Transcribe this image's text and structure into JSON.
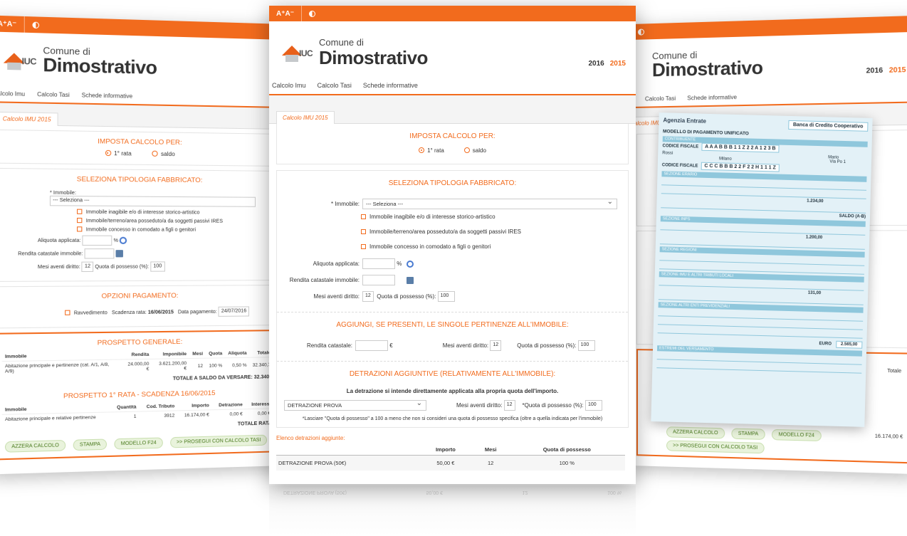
{
  "app": {
    "fontsize_label": "A⁺A⁻",
    "comune_label": "Comune di",
    "comune_name": "Dimostrativo",
    "logo_text": "IUC",
    "year_2016": "2016",
    "year_2015": "2015",
    "accent": "#f26b1d"
  },
  "nav": {
    "calcolo_imu": "Calcolo Imu",
    "calcolo_tasi": "Calcolo Tasi",
    "schede": "Schede informative"
  },
  "tab": {
    "label": "Calcolo IMU 2015"
  },
  "imposta": {
    "title": "IMPOSTA CALCOLO PER:",
    "prima_rata": "1° rata",
    "saldo": "saldo"
  },
  "tipologia": {
    "title": "SELEZIONA TIPOLOGIA FABBRICATO:",
    "immobile_label": "* Immobile:",
    "immobile_value": "--- Seleziona ---",
    "opt1": "Immobile inagibile e/o di interesse storico-artistico",
    "opt2": "Immobile/terreno/area posseduto/a da soggetti passivi IRES",
    "opt3": "Immobile concesso in comodato a figli o genitori",
    "aliquota_label": "Aliquota applicata:",
    "aliquota_unit": "%",
    "rendita_label": "Rendita catastale immobile:",
    "mesi_label": "Mesi aventi diritto:",
    "mesi_value": "12",
    "quota_label": "Quota di possesso (%):",
    "quota_value": "100"
  },
  "pertinenze": {
    "title": "AGGIUNGI, SE PRESENTI, LE SINGOLE PERTINENZE ALL'IMMOBILE:",
    "rendita_label": "Rendita catastale:",
    "euro": "€",
    "mesi_label": "Mesi aventi diritto:",
    "mesi_value": "12",
    "quota_label": "Quota di possesso (%):",
    "quota_value": "100"
  },
  "detrazioni": {
    "title": "DETRAZIONI AGGIUNTIVE (RELATIVAMENTE ALL'IMMOBILE):",
    "note": "La detrazione si intende direttamente applicata alla propria quota dell'importo.",
    "select_value": "DETRAZIONE PROVA",
    "mesi_label": "Mesi aventi diritto:",
    "mesi_value": "12",
    "quota_label": "*Quota di possesso (%):",
    "quota_value": "100",
    "footnote": "*Lasciare \"Quota di possesso\" a 100 a meno che non si consideri una quota di possesso specifica (oltre a quella indicata per l'immobile)",
    "elenco_title": "Elenco detrazioni aggiunte:",
    "headers": [
      "Importo",
      "Mesi",
      "Quota di possesso"
    ],
    "row": {
      "name": "DETRAZIONE PROVA (50€)",
      "importo": "50,00 €",
      "mesi": "12",
      "quota": "100 %"
    }
  },
  "opzioni": {
    "title": "OPZIONI PAGAMENTO:",
    "ravvedimento": "Ravvedimento",
    "scadenza_label": "Scadenza rata:",
    "scadenza_value": "16/06/2015",
    "data_label": "Data pagamento:",
    "data_value": "24/07/2016"
  },
  "prospetto": {
    "title": "PROSPETTO GENERALE:",
    "headers": [
      "Immobile",
      "Rendita",
      "Imponibile",
      "Mesi",
      "Quota",
      "Aliquota",
      "Totale"
    ],
    "row": [
      "Abitazione principale e pertinenze (cat. A/1, A/8, A/9)",
      "24.000,00 €",
      "3.621.200,00 €",
      "12",
      "100 %",
      "0,50 %",
      "32.340,7"
    ],
    "totale": "TOTALE A SALDO DA VERSARE:",
    "totale_value": "32.340,7"
  },
  "prospetto_rata": {
    "title": "PROSPETTO 1° RATA - SCADENZA 16/06/2015",
    "headers": [
      "Immobile",
      "Quantità",
      "Cod. Tributo",
      "Importo",
      "Detrazione",
      "Interessi"
    ],
    "row": [
      "Abitazione principale e relative pertinenze",
      "1",
      "3912",
      "16.174,00 €",
      "0,00 €",
      "0,00 €"
    ],
    "totale": "TOTALE RATA:",
    "totale_value": "16.174,00 €"
  },
  "buttons": {
    "azzera": "AZZERA CALCOLO",
    "stampa": "STAMPA",
    "f24": "MODELLO F24",
    "prosegui": ">> PROSEGUI CON CALCOLO TASI"
  },
  "f24": {
    "agenzia": "Agenzia Entrate",
    "banca": "Banca di Credito Cooperativo",
    "title": "MODELLO DI PAGAMENTO UNIFICATO",
    "codice_fiscale": "A A A B B B 1 1 Z 2 2 A 1 2 3 B",
    "cognome": "Rossi",
    "nome": "Mario",
    "citta": "Milano",
    "indirizzo": "Via Po 1",
    "codice2": "C C C B B B 2 2 F 2 2 H 1 1 1 Z",
    "saldo_label": "SALDO (A-B)",
    "importo1": "1.234,00",
    "importo2": "1.200,00",
    "importo3": "131,00",
    "totale_finale": "2.565,00",
    "euro": "EURO"
  }
}
